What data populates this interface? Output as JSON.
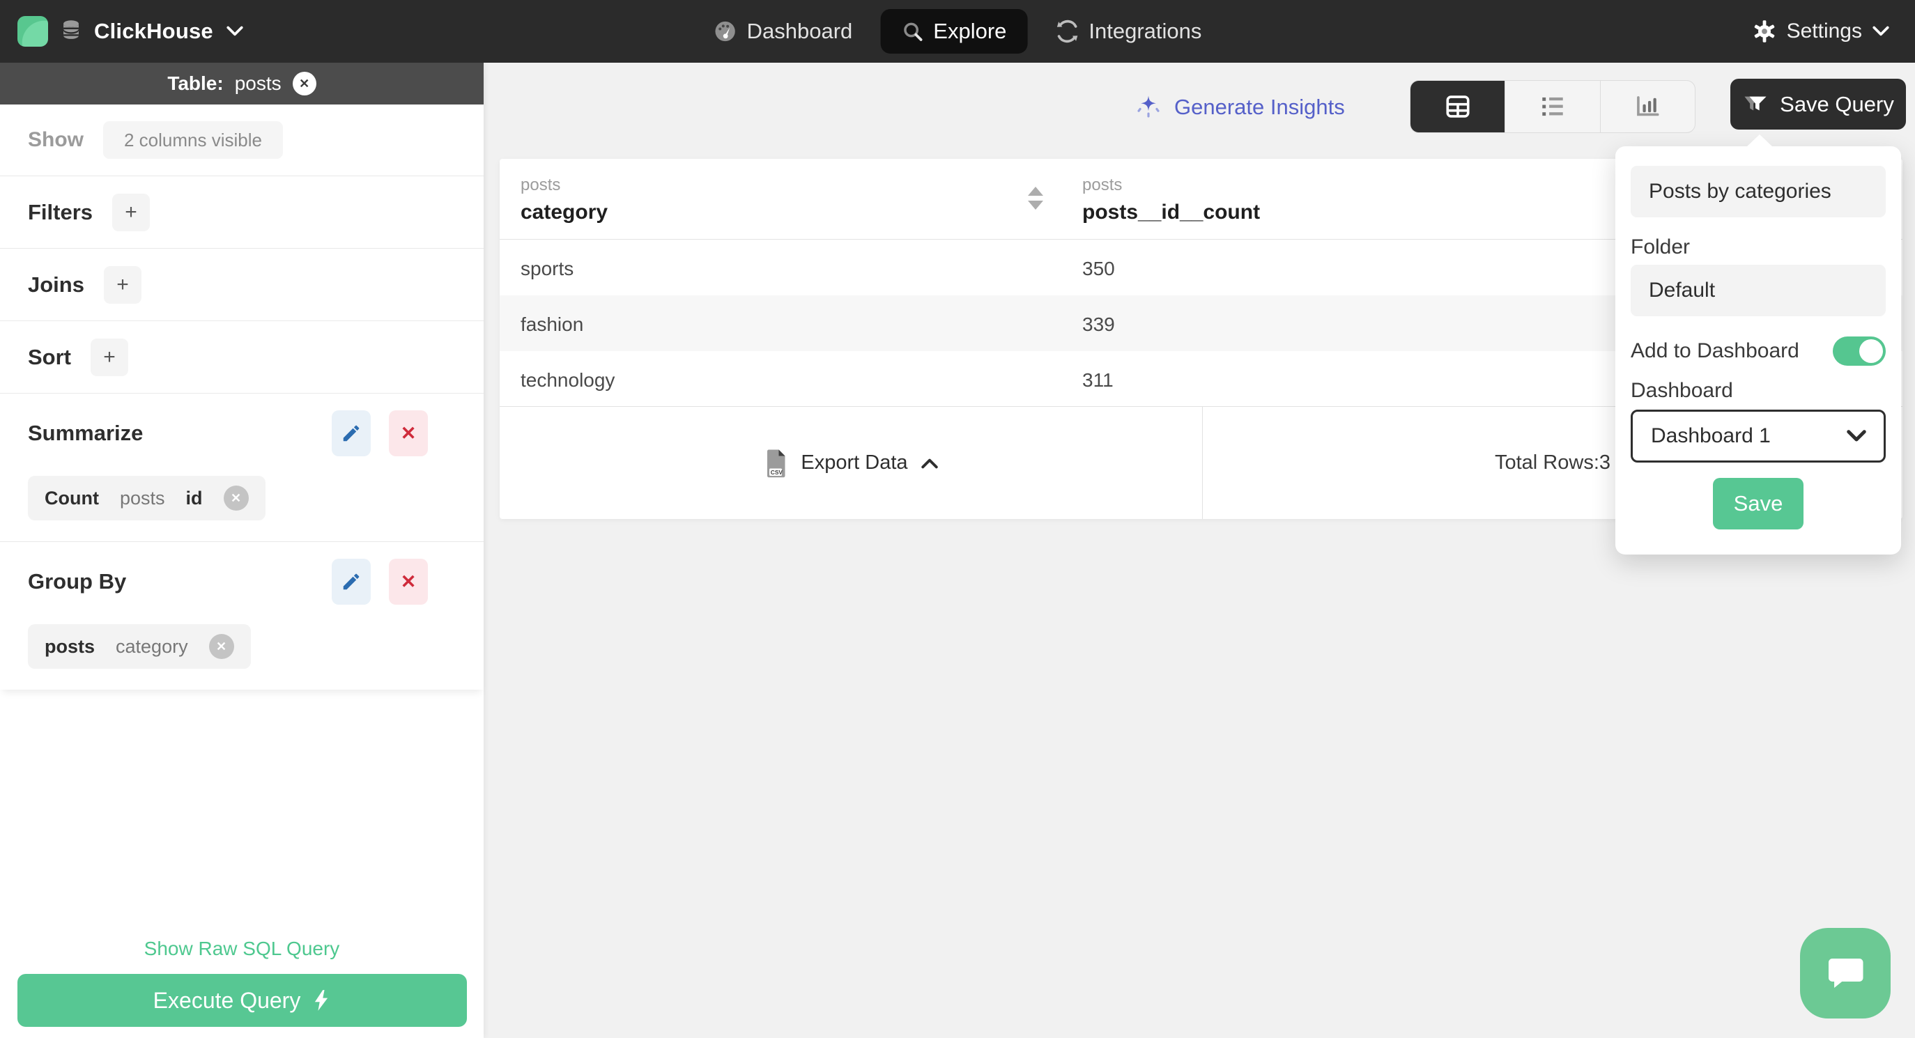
{
  "colors": {
    "green": "#57c793",
    "indigo": "#5560c9",
    "navbar_dark": "#2b2b2b",
    "active_dark": "#2e2e2e"
  },
  "navbar": {
    "brand": "ClickHouse",
    "tabs": [
      {
        "label": "Dashboard",
        "active": false
      },
      {
        "label": "Explore",
        "active": true
      },
      {
        "label": "Integrations",
        "active": false
      }
    ],
    "settings_label": "Settings"
  },
  "sidebar": {
    "table_header": {
      "prefix": "Table:",
      "name": "posts"
    },
    "show_label": "Show",
    "columns_chip": "2 columns visible",
    "sections": [
      {
        "label": "Filters",
        "add": "+"
      },
      {
        "label": "Joins",
        "add": "+"
      },
      {
        "label": "Sort",
        "add": "+"
      }
    ],
    "summarize": {
      "title": "Summarize",
      "chip": {
        "agg": "Count",
        "table": "posts",
        "column": "id"
      }
    },
    "group_by": {
      "title": "Group By",
      "chip": {
        "table": "posts",
        "column": "category"
      }
    },
    "raw_sql_link": "Show Raw SQL Query",
    "execute_button": "Execute Query"
  },
  "main": {
    "generate_insights": "Generate Insights",
    "save_query_button": "Save Query",
    "table": {
      "col1_caption": "posts",
      "col1_name": "category",
      "col2_caption": "posts",
      "col2_name": "posts__id__count",
      "rows": [
        {
          "category": "sports",
          "count": "350"
        },
        {
          "category": "fashion",
          "count": "339"
        },
        {
          "category": "technology",
          "count": "311"
        }
      ]
    },
    "footer": {
      "export_label": "Export Data",
      "total_label": "Total Rows:3"
    }
  },
  "popover": {
    "name_value": "Posts by categories",
    "folder_label": "Folder",
    "folder_value": "Default",
    "add_to_dashboard_label": "Add to Dashboard",
    "toggle_on": true,
    "dashboard_label": "Dashboard",
    "dashboard_value": "Dashboard 1",
    "save_label": "Save"
  }
}
